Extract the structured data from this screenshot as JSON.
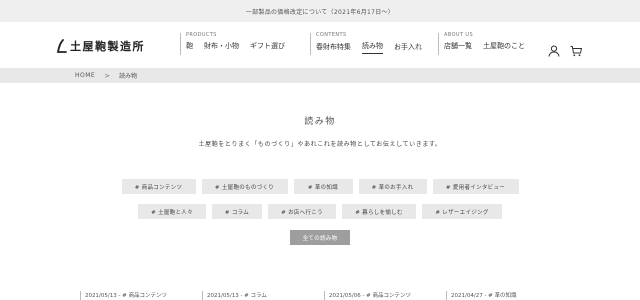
{
  "announcement": "一部製品の価格改定について（2021年6月17日〜）",
  "logo": {
    "text": "土屋鞄製造所"
  },
  "nav": {
    "products": {
      "category": "PRODUCTS",
      "items": [
        "鞄",
        "財布・小物",
        "ギフト選び"
      ]
    },
    "contents": {
      "category": "CONTENTS",
      "items": [
        "春財布特集",
        "読み物",
        "お手入れ"
      ]
    },
    "about": {
      "category": "ABOUT US",
      "items": [
        "店舗一覧",
        "土屋鞄のこと"
      ]
    }
  },
  "icons": {
    "account": "user-icon",
    "cart": "cart-icon"
  },
  "breadcrumb": {
    "home": "HOME",
    "separator": ">",
    "current": "読み物"
  },
  "page": {
    "title": "読み物",
    "lead": "土屋鞄をとりまく「ものづくり」やあれこれを読み物としてお伝えしていきます。"
  },
  "tags_row1": [
    "# 商品コンテンツ",
    "# 土屋鞄のものづくり",
    "# 革の知識",
    "# 革のお手入れ",
    "# 愛用者インタビュー"
  ],
  "tags_row2": [
    "# 土屋鞄と人々",
    "# コラム",
    "# お店へ行こう",
    "# 暮らしを愉しむ",
    "# レザーエイジング"
  ],
  "all_button": "全ての読み物",
  "posts": [
    "2021/05/13 - # 商品コンテンツ",
    "2021/05/13 - # コラム",
    "2021/05/06 - # 商品コンテンツ",
    "2021/04/27 - # 革の知識"
  ],
  "colors": {
    "tag_bg": "#e8e8e8",
    "all_button_bg": "#9e9e9e",
    "announce_bg": "#efefef"
  }
}
